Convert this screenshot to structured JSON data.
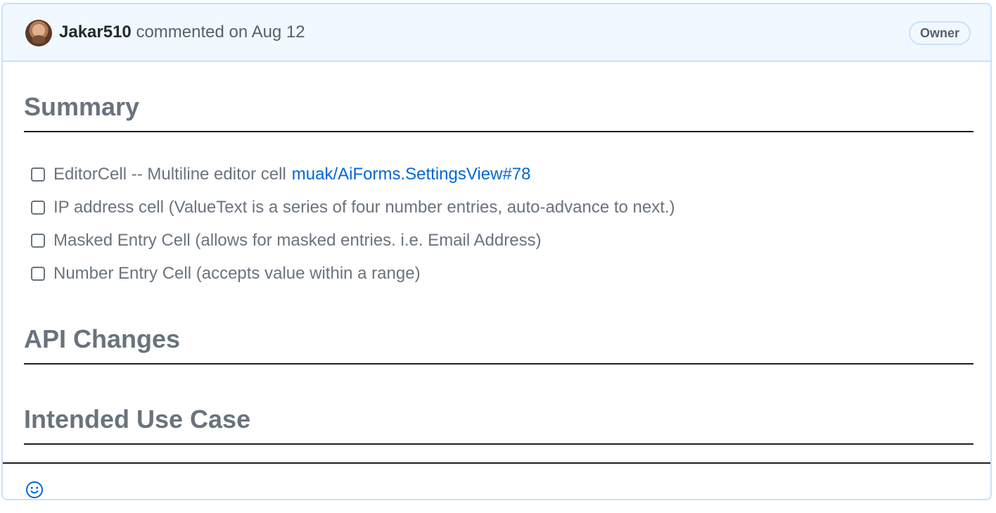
{
  "comment": {
    "author": "Jakar510",
    "action_text": "commented on",
    "date": "Aug 12",
    "badge": "Owner"
  },
  "body": {
    "sections": {
      "summary": "Summary",
      "api_changes": "API Changes",
      "intended_use_case": "Intended Use Case"
    },
    "tasks": [
      {
        "text": "EditorCell -- Multiline editor cell",
        "link": "muak/AiForms.SettingsView#78",
        "checked": false
      },
      {
        "text": "IP address cell (ValueText is a series of four number entries, auto-advance to next.)",
        "checked": false
      },
      {
        "text": "Masked Entry Cell (allows for masked entries. i.e. Email Address)",
        "checked": false
      },
      {
        "text": "Number Entry Cell (accepts value within a range)",
        "checked": false
      }
    ]
  },
  "footer": {
    "reaction_icon": "smiley-icon"
  },
  "colors": {
    "header_bg": "#f1f8ff",
    "border": "#c8e1ff",
    "link": "#0366d6",
    "muted_text": "#6a737d",
    "author_text": "#24292e"
  }
}
